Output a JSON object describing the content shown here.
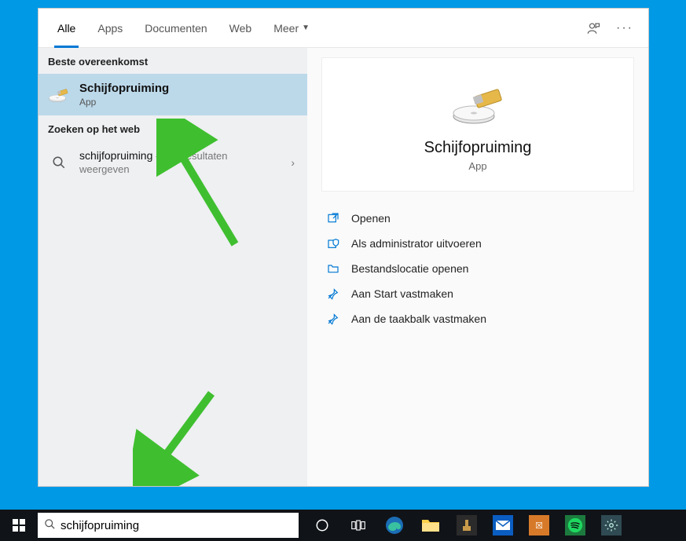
{
  "tabs": {
    "all": "Alle",
    "apps": "Apps",
    "documents": "Documenten",
    "web": "Web",
    "more": "Meer"
  },
  "sections": {
    "best_match": "Beste overeenkomst",
    "web_search": "Zoeken op het web"
  },
  "results": {
    "app": {
      "title": "Schijfopruiming",
      "subtitle": "App"
    },
    "web": {
      "query": "schijfopruiming",
      "desc_prefix": " - Webresultaten",
      "desc_line2": "weergeven"
    }
  },
  "detail": {
    "title": "Schijfopruiming",
    "subtitle": "App"
  },
  "actions": {
    "open": "Openen",
    "admin": "Als administrator uitvoeren",
    "location": "Bestandslocatie openen",
    "pin_start": "Aan Start vastmaken",
    "pin_taskbar": "Aan de taakbalk vastmaken"
  },
  "search": {
    "value": "schijfopruiming"
  }
}
